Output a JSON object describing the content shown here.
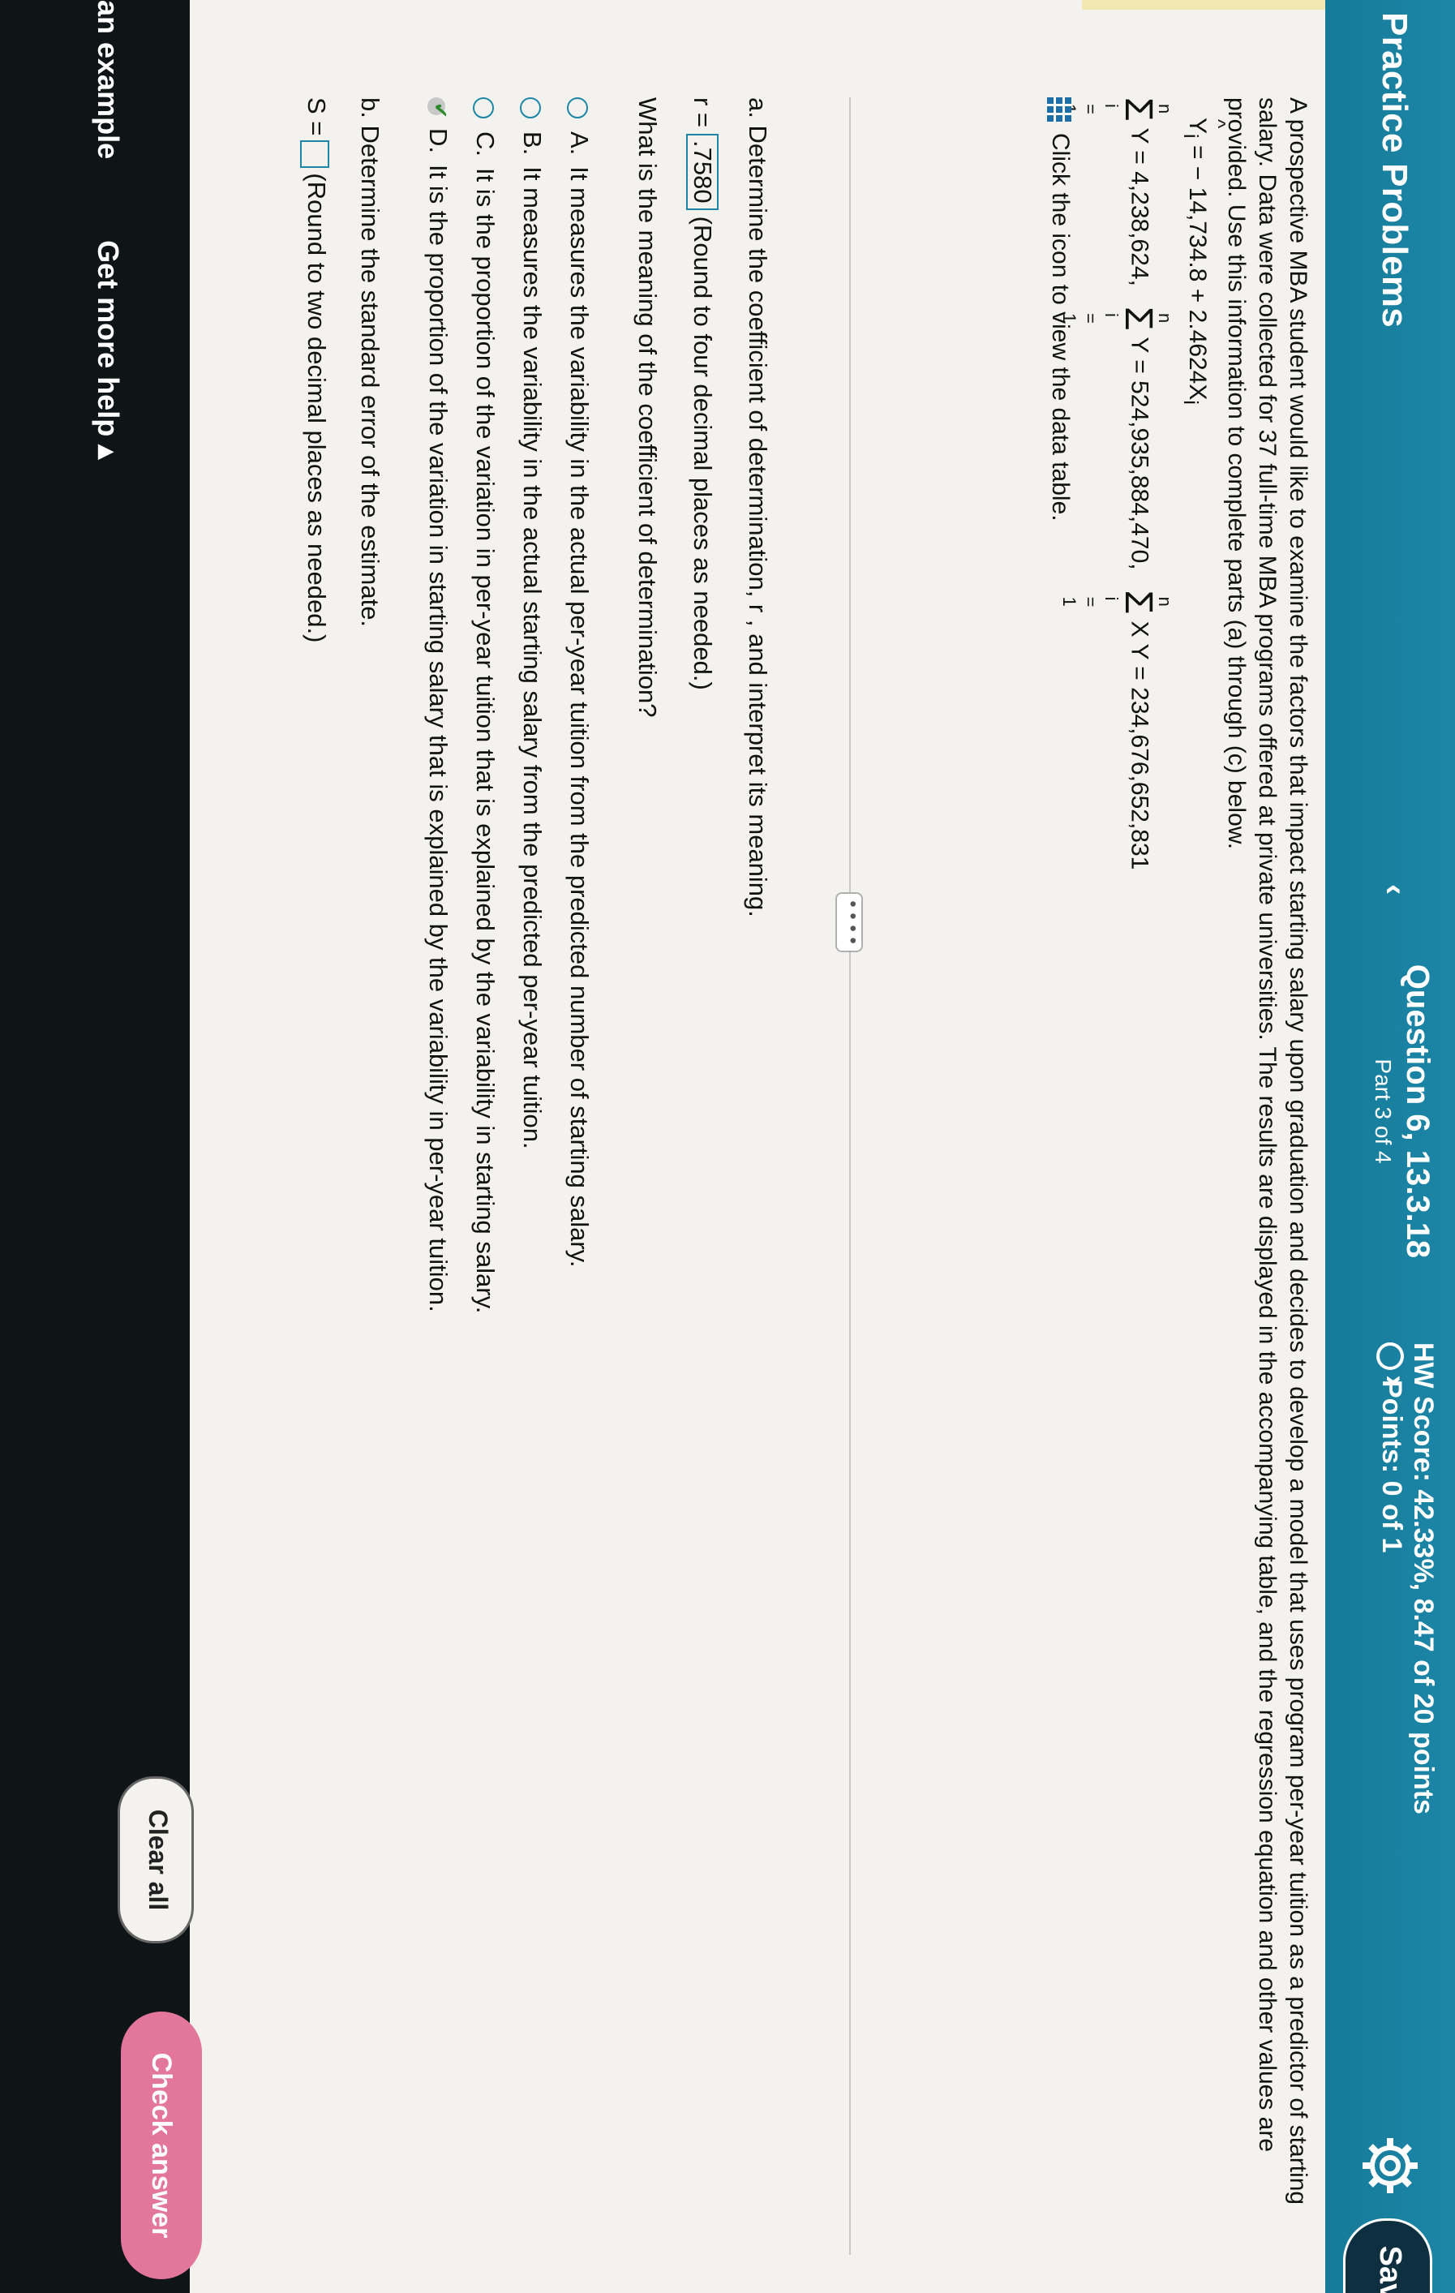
{
  "header": {
    "title": "Practice Problems",
    "question_title": "Question 6, 13.3.18",
    "question_part": "Part 3 of 4",
    "hw_score": "HW Score: 42.33%, 8.47 of 20 points",
    "points": "Points: 0 of 1",
    "save_label": "Save",
    "prev_icon": "chevron-left",
    "next_icon": "chevron-right"
  },
  "problem": {
    "intro_line1": "A prospective MBA student would like to examine the factors that impact starting salary upon graduation and decides to develop a model that uses program per-year tuition as a predictor of starting",
    "intro_line2": "salary. Data were collected for 37 full-time MBA programs offered at private universities. The results are displayed in the accompanying table, and the regression equation and other values are",
    "intro_line3": "provided. Use this information to complete parts (a) through (c) below.",
    "regression_eq": "= − 14,734.8 + 2.4624X",
    "sum_y": "Y = 4,238,624,",
    "sum_y2": "Y  = 524,935,884,470,",
    "sum_xy": "X Y = 234,676,652,831",
    "data_link": "Click the icon to view the data table."
  },
  "part_a": {
    "prompt": "a. Determine the coefficient of determination, r , and interpret its meaning.",
    "r2_label": "r  =",
    "r2_value": ".7580",
    "r2_hint": "(Round to four decimal places as needed.)",
    "meaning_question": "What is the meaning of the coefficient of determination?",
    "options": [
      {
        "letter": "A.",
        "text": "It measures the variability in the actual per-year tuition from the predicted number of starting salary."
      },
      {
        "letter": "B.",
        "text": "It measures the variability in the actual starting salary from the predicted per-year tuition."
      },
      {
        "letter": "C.",
        "text": "It is the proportion of the variation in per-year tuition that is explained by the variability in starting salary."
      },
      {
        "letter": "D.",
        "text": "It is the proportion of the variation in starting salary that is explained by the variability in per-year tuition."
      }
    ]
  },
  "part_b": {
    "prompt": "b. Determine the standard error of the estimate.",
    "syx_label": "S  =",
    "syx_hint": "(Round to two decimal places as needed.)"
  },
  "footer": {
    "example": "an example",
    "more_help": "Get more help ▴",
    "clear_all": "Clear all",
    "check_answer": "Check answer"
  },
  "colors": {
    "header_bg": "#1c86a7",
    "check_answer_bg": "#e2779b"
  }
}
